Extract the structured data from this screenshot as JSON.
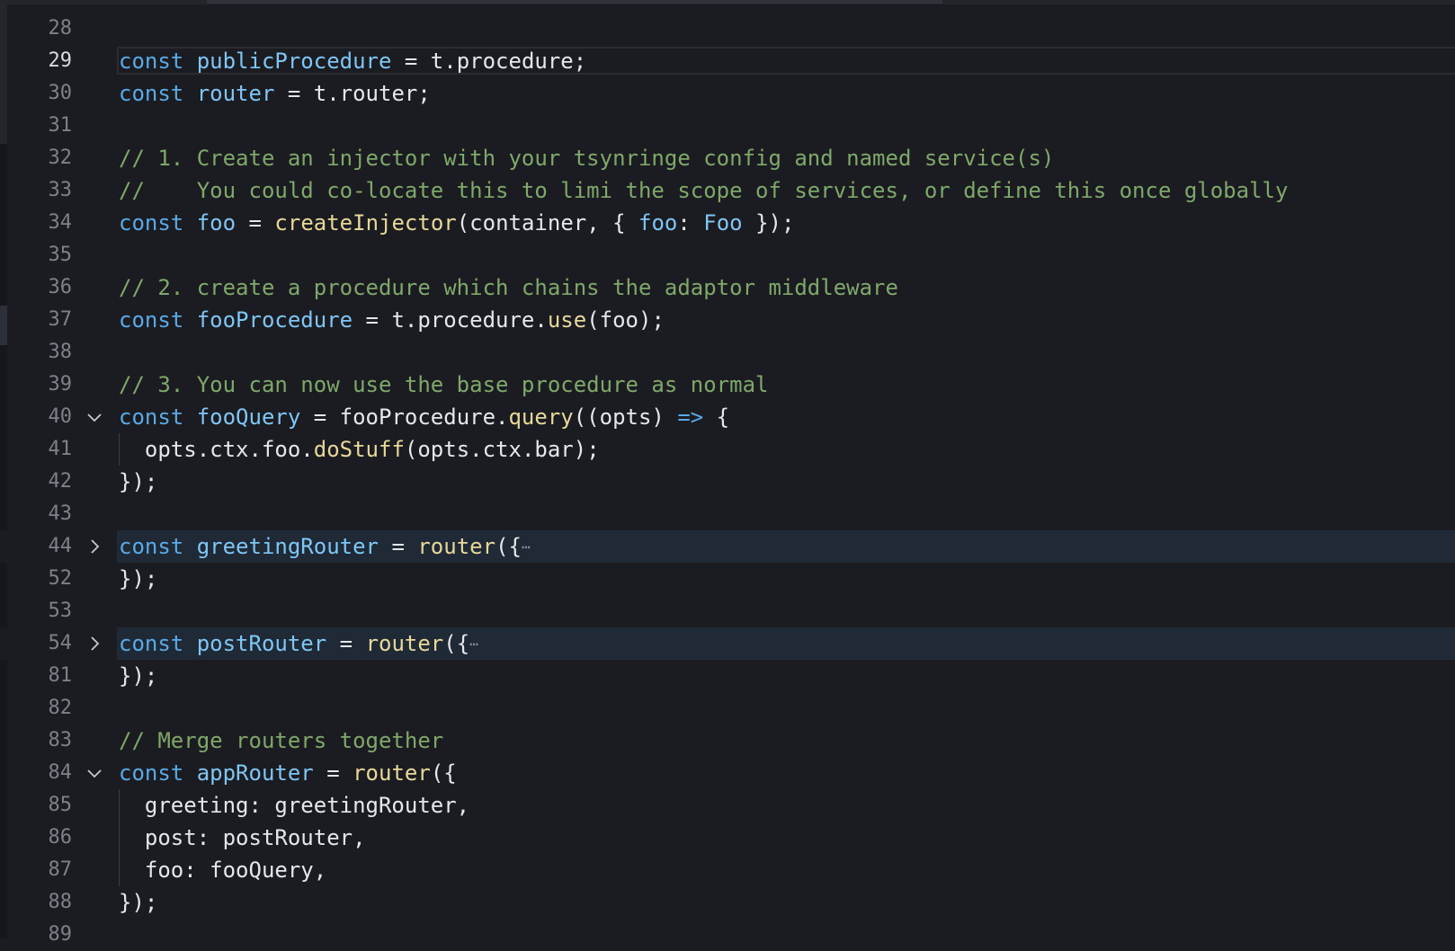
{
  "editor": {
    "lines": [
      {
        "n": "28",
        "fold": "",
        "indent": false,
        "current": false,
        "folded": false,
        "tokens": []
      },
      {
        "n": "29",
        "fold": "",
        "indent": false,
        "current": true,
        "folded": false,
        "tokens": [
          {
            "t": "const",
            "c": "k"
          },
          {
            "t": " ",
            "c": "t"
          },
          {
            "t": "publicProcedure",
            "c": "v"
          },
          {
            "t": " = t.procedure;",
            "c": "t"
          }
        ]
      },
      {
        "n": "30",
        "fold": "",
        "indent": false,
        "current": false,
        "folded": false,
        "tokens": [
          {
            "t": "const",
            "c": "k"
          },
          {
            "t": " ",
            "c": "t"
          },
          {
            "t": "router",
            "c": "v"
          },
          {
            "t": " = t.router;",
            "c": "t"
          }
        ]
      },
      {
        "n": "31",
        "fold": "",
        "indent": false,
        "current": false,
        "folded": false,
        "tokens": []
      },
      {
        "n": "32",
        "fold": "",
        "indent": false,
        "current": false,
        "folded": false,
        "tokens": [
          {
            "t": "// 1. Create an injector with your tsynringe config and named service(s)",
            "c": "c"
          }
        ]
      },
      {
        "n": "33",
        "fold": "",
        "indent": false,
        "current": false,
        "folded": false,
        "tokens": [
          {
            "t": "//    You could co-locate this to limi the scope of services, or define this once globally",
            "c": "c"
          }
        ]
      },
      {
        "n": "34",
        "fold": "",
        "indent": false,
        "current": false,
        "folded": false,
        "tokens": [
          {
            "t": "const",
            "c": "k"
          },
          {
            "t": " ",
            "c": "t"
          },
          {
            "t": "foo",
            "c": "v"
          },
          {
            "t": " = ",
            "c": "t"
          },
          {
            "t": "createInjector",
            "c": "f"
          },
          {
            "t": "(container, { ",
            "c": "t"
          },
          {
            "t": "foo",
            "c": "v"
          },
          {
            "t": ": ",
            "c": "t"
          },
          {
            "t": "Foo",
            "c": "v"
          },
          {
            "t": " });",
            "c": "t"
          }
        ]
      },
      {
        "n": "35",
        "fold": "",
        "indent": false,
        "current": false,
        "folded": false,
        "tokens": []
      },
      {
        "n": "36",
        "fold": "",
        "indent": false,
        "current": false,
        "folded": false,
        "tokens": [
          {
            "t": "// 2. create a procedure which chains the adaptor middleware",
            "c": "c"
          }
        ]
      },
      {
        "n": "37",
        "fold": "",
        "indent": false,
        "current": false,
        "folded": false,
        "tokens": [
          {
            "t": "const",
            "c": "k"
          },
          {
            "t": " ",
            "c": "t"
          },
          {
            "t": "fooProcedure",
            "c": "v"
          },
          {
            "t": " = t.procedure.",
            "c": "t"
          },
          {
            "t": "use",
            "c": "f"
          },
          {
            "t": "(foo);",
            "c": "t"
          }
        ]
      },
      {
        "n": "38",
        "fold": "",
        "indent": false,
        "current": false,
        "folded": false,
        "tokens": []
      },
      {
        "n": "39",
        "fold": "",
        "indent": false,
        "current": false,
        "folded": false,
        "tokens": [
          {
            "t": "// 3. You can now use the base procedure as normal",
            "c": "c"
          }
        ]
      },
      {
        "n": "40",
        "fold": "open",
        "indent": false,
        "current": false,
        "folded": false,
        "tokens": [
          {
            "t": "const",
            "c": "k"
          },
          {
            "t": " ",
            "c": "t"
          },
          {
            "t": "fooQuery",
            "c": "v"
          },
          {
            "t": " = fooProcedure.",
            "c": "t"
          },
          {
            "t": "query",
            "c": "f"
          },
          {
            "t": "((opts) ",
            "c": "t"
          },
          {
            "t": "=>",
            "c": "k"
          },
          {
            "t": " {",
            "c": "t"
          }
        ]
      },
      {
        "n": "41",
        "fold": "",
        "indent": true,
        "current": false,
        "folded": false,
        "tokens": [
          {
            "t": "  opts.ctx.foo.",
            "c": "t"
          },
          {
            "t": "doStuff",
            "c": "f"
          },
          {
            "t": "(opts.ctx.bar);",
            "c": "t"
          }
        ]
      },
      {
        "n": "42",
        "fold": "",
        "indent": false,
        "current": false,
        "folded": false,
        "tokens": [
          {
            "t": "});",
            "c": "t"
          }
        ]
      },
      {
        "n": "43",
        "fold": "",
        "indent": false,
        "current": false,
        "folded": false,
        "tokens": []
      },
      {
        "n": "44",
        "fold": "closed",
        "indent": false,
        "current": false,
        "folded": true,
        "tokens": [
          {
            "t": "const",
            "c": "k"
          },
          {
            "t": " ",
            "c": "t"
          },
          {
            "t": "greetingRouter",
            "c": "v"
          },
          {
            "t": " = ",
            "c": "t"
          },
          {
            "t": "router",
            "c": "f"
          },
          {
            "t": "({",
            "c": "t"
          },
          {
            "t": "⋯",
            "c": "ell"
          }
        ]
      },
      {
        "n": "52",
        "fold": "",
        "indent": false,
        "current": false,
        "folded": false,
        "tokens": [
          {
            "t": "});",
            "c": "t"
          }
        ]
      },
      {
        "n": "53",
        "fold": "",
        "indent": false,
        "current": false,
        "folded": false,
        "tokens": []
      },
      {
        "n": "54",
        "fold": "closed",
        "indent": false,
        "current": false,
        "folded": true,
        "tokens": [
          {
            "t": "const",
            "c": "k"
          },
          {
            "t": " ",
            "c": "t"
          },
          {
            "t": "postRouter",
            "c": "v"
          },
          {
            "t": " = ",
            "c": "t"
          },
          {
            "t": "router",
            "c": "f"
          },
          {
            "t": "({",
            "c": "t"
          },
          {
            "t": "⋯",
            "c": "ell"
          }
        ]
      },
      {
        "n": "81",
        "fold": "",
        "indent": false,
        "current": false,
        "folded": false,
        "tokens": [
          {
            "t": "});",
            "c": "t"
          }
        ]
      },
      {
        "n": "82",
        "fold": "",
        "indent": false,
        "current": false,
        "folded": false,
        "tokens": []
      },
      {
        "n": "83",
        "fold": "",
        "indent": false,
        "current": false,
        "folded": false,
        "tokens": [
          {
            "t": "// Merge routers together",
            "c": "c"
          }
        ]
      },
      {
        "n": "84",
        "fold": "open",
        "indent": false,
        "current": false,
        "folded": false,
        "tokens": [
          {
            "t": "const",
            "c": "k"
          },
          {
            "t": " ",
            "c": "t"
          },
          {
            "t": "appRouter",
            "c": "v"
          },
          {
            "t": " = ",
            "c": "t"
          },
          {
            "t": "router",
            "c": "f"
          },
          {
            "t": "({",
            "c": "t"
          }
        ]
      },
      {
        "n": "85",
        "fold": "",
        "indent": true,
        "current": false,
        "folded": false,
        "tokens": [
          {
            "t": "  greeting: greetingRouter,",
            "c": "t"
          }
        ]
      },
      {
        "n": "86",
        "fold": "",
        "indent": true,
        "current": false,
        "folded": false,
        "tokens": [
          {
            "t": "  post: postRouter,",
            "c": "t"
          }
        ]
      },
      {
        "n": "87",
        "fold": "",
        "indent": true,
        "current": false,
        "folded": false,
        "tokens": [
          {
            "t": "  foo: fooQuery,",
            "c": "t"
          }
        ]
      },
      {
        "n": "88",
        "fold": "",
        "indent": false,
        "current": false,
        "folded": false,
        "tokens": [
          {
            "t": "});",
            "c": "t"
          }
        ]
      },
      {
        "n": "89",
        "fold": "",
        "indent": false,
        "current": false,
        "folded": false,
        "tokens": []
      }
    ]
  }
}
